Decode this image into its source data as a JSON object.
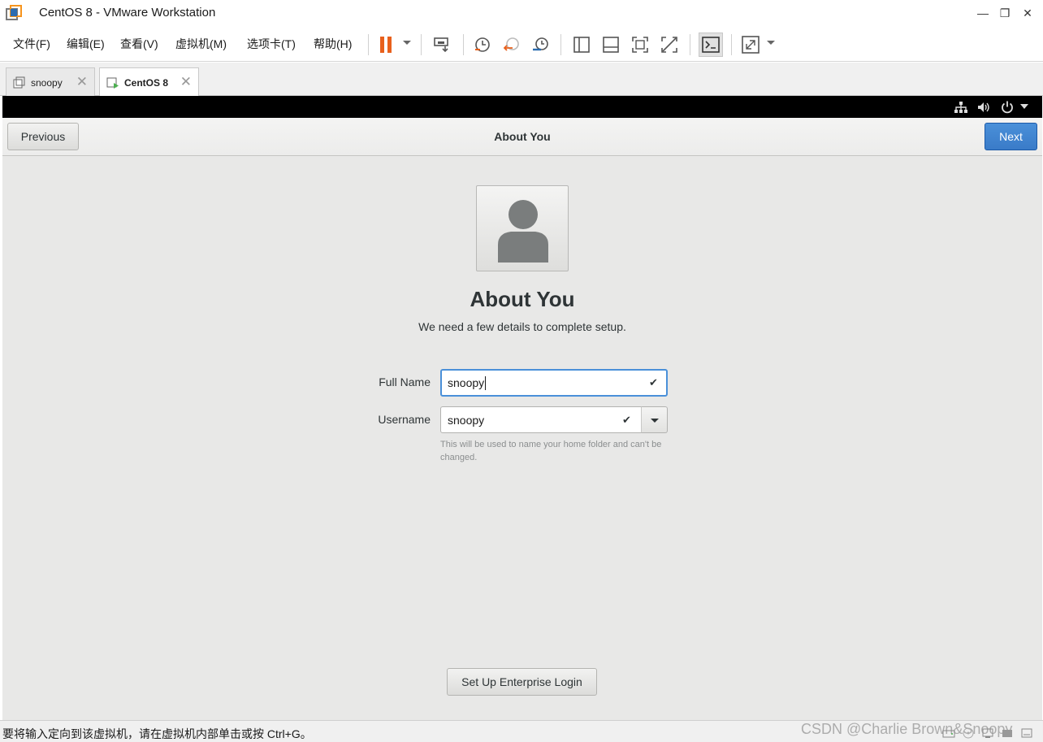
{
  "window": {
    "title": "CentOS 8 - VMware Workstation",
    "minimize": "—",
    "restore": "❐",
    "close": "✕"
  },
  "menu": {
    "items": [
      "文件(F)",
      "编辑(E)",
      "查看(V)",
      "虚拟机(M)",
      "选项卡(T)",
      "帮助(H)"
    ]
  },
  "tabs": [
    {
      "label": "snoopy",
      "close": "✕"
    },
    {
      "label": "CentOS 8",
      "close": "✕"
    }
  ],
  "setup": {
    "previous": "Previous",
    "header_title": "About You",
    "next": "Next",
    "heading": "About You",
    "subtitle": "We need a few details to complete setup.",
    "full_name_label": "Full Name",
    "full_name_value": "snoopy",
    "username_label": "Username",
    "username_value": "snoopy",
    "check": "✔",
    "hint": "This will be used to name your home folder and can't be changed.",
    "enterprise": "Set Up Enterprise Login"
  },
  "status": {
    "message": "要将输入定向到该虚拟机，请在虚拟机内部单击或按 Ctrl+G。",
    "watermark": "CSDN @Charlie Brown&Snoopy"
  },
  "colors": {
    "accent": "#4a90d9",
    "pause_orange": "#e8601c",
    "vm_background": "#e8e8e7"
  }
}
